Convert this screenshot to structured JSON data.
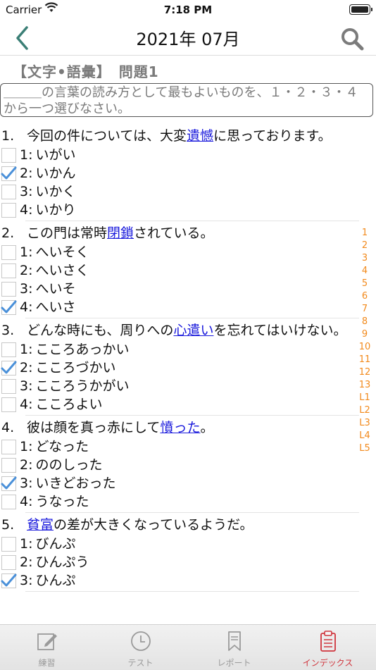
{
  "status": {
    "carrier": "Carrier",
    "time": "7:18 PM"
  },
  "nav": {
    "title": "2021年 07月"
  },
  "section": {
    "heading": "【文字•語彙】　問題1"
  },
  "instruction": "＿＿＿の言葉の読み方として最もよいものを、１・２・３・４から一つ選びなさい。",
  "questions": [
    {
      "number": "1.",
      "before": "今回の件については、大変",
      "target": "遺憾",
      "after": "に思っております。",
      "options": [
        {
          "label": "1:",
          "text": "いがい",
          "checked": false
        },
        {
          "label": "2:",
          "text": "いかん",
          "checked": true
        },
        {
          "label": "3:",
          "text": "いかく",
          "checked": false
        },
        {
          "label": "4:",
          "text": "いかり",
          "checked": false
        }
      ]
    },
    {
      "number": "2.",
      "before": "この門は常時",
      "target": "閉鎖",
      "after": "されている。",
      "options": [
        {
          "label": "1:",
          "text": "へいそく",
          "checked": false
        },
        {
          "label": "2:",
          "text": "へいさく",
          "checked": false
        },
        {
          "label": "3:",
          "text": "へいそ",
          "checked": false
        },
        {
          "label": "4:",
          "text": "へいさ",
          "checked": true
        }
      ]
    },
    {
      "number": "3.",
      "before": "どんな時にも、周りへの",
      "target": "心遣い",
      "after": "を忘れてはいけない。",
      "options": [
        {
          "label": "1:",
          "text": "こころあっかい",
          "checked": false
        },
        {
          "label": "2:",
          "text": "こころづかい",
          "checked": true
        },
        {
          "label": "3:",
          "text": "こころうかがい",
          "checked": false
        },
        {
          "label": "4:",
          "text": "こころよい",
          "checked": false
        }
      ]
    },
    {
      "number": "4.",
      "before": "彼は顔を真っ赤にして",
      "target": "憤った",
      "after": "。",
      "options": [
        {
          "label": "1:",
          "text": "どなった",
          "checked": false
        },
        {
          "label": "2:",
          "text": "ののしった",
          "checked": false
        },
        {
          "label": "3:",
          "text": "いきどおった",
          "checked": true
        },
        {
          "label": "4:",
          "text": "うなった",
          "checked": false
        }
      ]
    },
    {
      "number": "5.",
      "before": "",
      "target": "貧富",
      "after": "の差が大きくなっているようだ。",
      "options": [
        {
          "label": "1:",
          "text": "びんぷ",
          "checked": false
        },
        {
          "label": "2:",
          "text": "ひんぷう",
          "checked": false
        },
        {
          "label": "3:",
          "text": "ひんぷ",
          "checked": true
        }
      ]
    }
  ],
  "index": [
    "1",
    "2",
    "3",
    "4",
    "5",
    "6",
    "7",
    "8",
    "9",
    "10",
    "11",
    "12",
    "13",
    "L1",
    "L2",
    "L3",
    "L4",
    "L5"
  ],
  "tabs": [
    {
      "label": "練習",
      "icon": "pencil-square-icon"
    },
    {
      "label": "テスト",
      "icon": "clock-icon"
    },
    {
      "label": "レポート",
      "icon": "bookmark-icon"
    },
    {
      "label": "インデックス",
      "icon": "clipboard-icon"
    }
  ],
  "colors": {
    "accent": "#4a90d9",
    "index": "#f28a1c",
    "active_tab": "#d0343c",
    "target_word": "#1a1adc"
  }
}
